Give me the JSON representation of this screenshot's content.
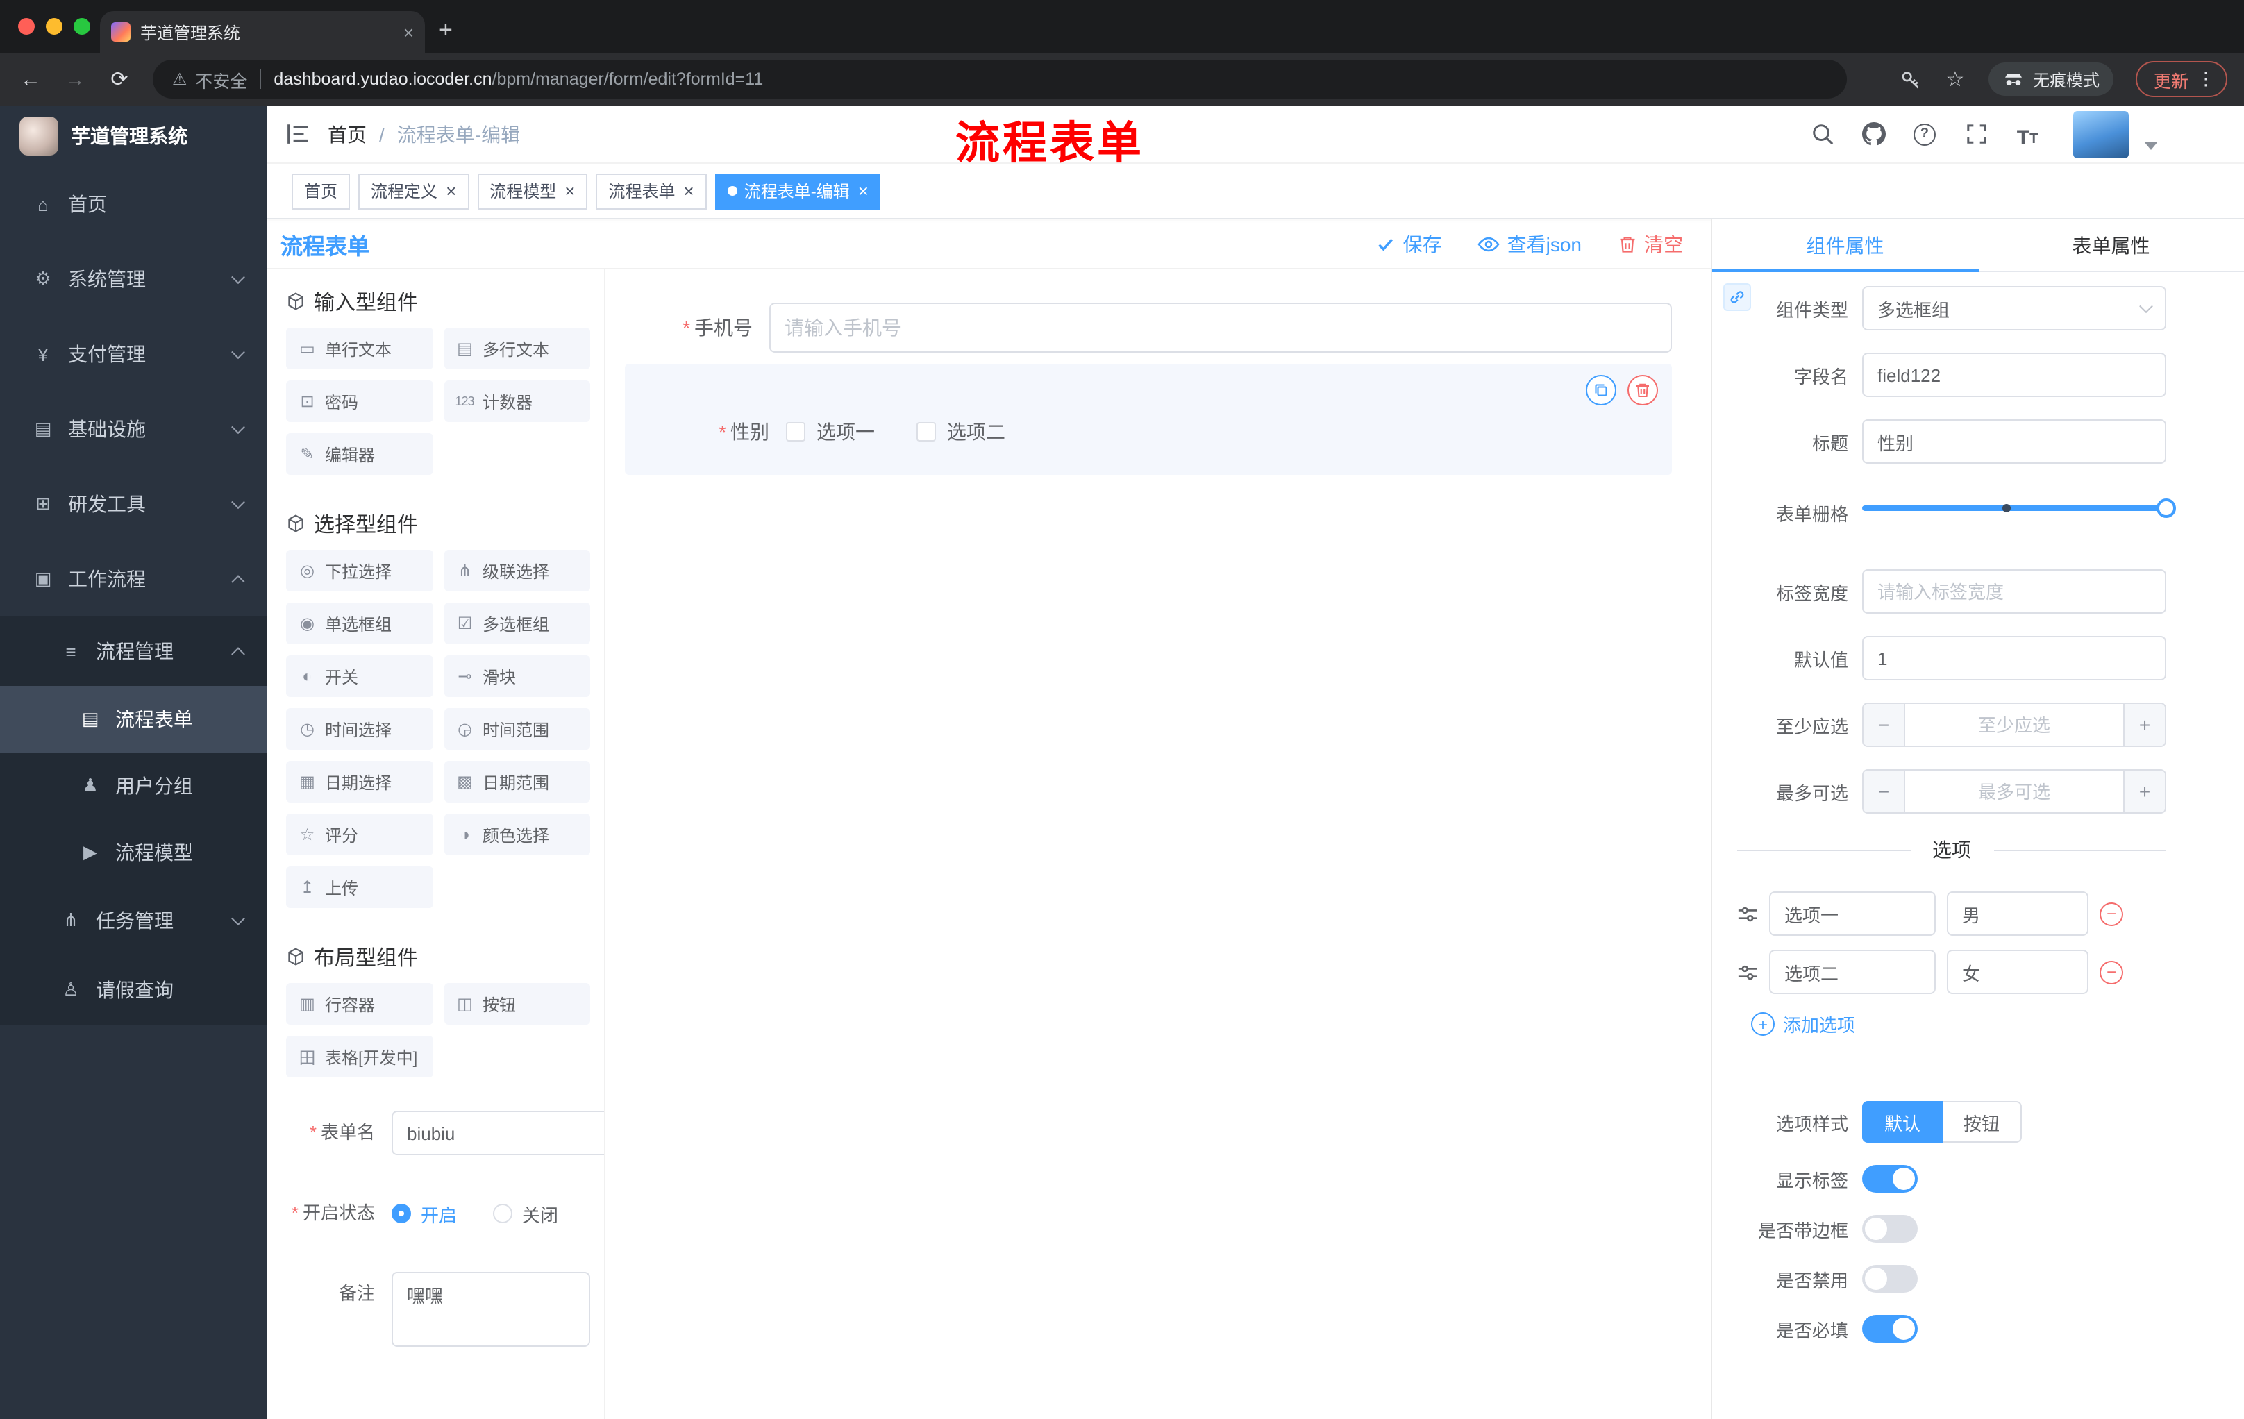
{
  "colors": {
    "accent": "#409eff",
    "danger": "#f56c6c",
    "annotation_red": "#fe0000",
    "sidebar_bg": "#2a333f"
  },
  "glyphs": {
    "close": "×",
    "plus": "+",
    "back": "←",
    "forward": "→",
    "reload": "⟳",
    "warning": "⚠",
    "star": "☆",
    "dots": "⋮",
    "required": "*",
    "minus": "−",
    "help": "?",
    "font_size": "T"
  },
  "browser": {
    "tab_title": "芋道管理系统",
    "security_label": "不安全",
    "url_host": "dashboard.yudao.iocoder.cn",
    "url_path": "/bpm/manager/form/edit?formId=11",
    "incognito_label": "无痕模式",
    "update_label": "更新"
  },
  "sidebar": {
    "app_title": "芋道管理系统",
    "items": [
      {
        "label": "首页",
        "icon": "home-icon",
        "glyph": "⌂"
      },
      {
        "label": "系统管理",
        "icon": "gear-icon",
        "glyph": "⚙"
      },
      {
        "label": "支付管理",
        "icon": "yen-icon",
        "glyph": "¥"
      },
      {
        "label": "基础设施",
        "icon": "infrastructure-icon",
        "glyph": "▤"
      },
      {
        "label": "研发工具",
        "icon": "dev-tools-icon",
        "glyph": "⊞"
      },
      {
        "label": "工作流程",
        "icon": "workflow-icon",
        "glyph": "▣",
        "children": [
          {
            "label": "流程管理",
            "icon": "list-icon",
            "glyph": "≡",
            "children": [
              {
                "label": "流程表单",
                "icon": "form-doc-icon",
                "glyph": "▤"
              },
              {
                "label": "用户分组",
                "icon": "user-group-icon",
                "glyph": "♟"
              },
              {
                "label": "流程模型",
                "icon": "model-icon",
                "glyph": "▶"
              }
            ]
          },
          {
            "label": "任务管理",
            "icon": "task-icon",
            "glyph": "⋔"
          },
          {
            "label": "请假查询",
            "icon": "person-icon",
            "glyph": "♙"
          }
        ]
      }
    ]
  },
  "header": {
    "breadcrumb": {
      "root": "首页",
      "separator": "/",
      "current": "流程表单-编辑"
    },
    "annotation": "流程表单",
    "icons": [
      "search-icon",
      "github-icon",
      "help-icon",
      "fullscreen-icon",
      "font-size-icon",
      "avatar"
    ]
  },
  "tags": {
    "items": [
      {
        "label": "首页",
        "closable": false,
        "active": false
      },
      {
        "label": "流程定义",
        "closable": true,
        "active": false
      },
      {
        "label": "流程模型",
        "closable": true,
        "active": false
      },
      {
        "label": "流程表单",
        "closable": true,
        "active": false
      },
      {
        "label": "流程表单-编辑",
        "closable": true,
        "active": true
      }
    ]
  },
  "designer": {
    "title": "流程表单",
    "actions": {
      "save": {
        "label": "保存",
        "icon": "check-icon"
      },
      "view_json": {
        "label": "查看json",
        "icon": "eye-icon"
      },
      "clear": {
        "label": "清空",
        "icon": "trash-icon"
      }
    },
    "palette": {
      "sections": [
        {
          "title": "输入型组件",
          "icon": "cube-icon",
          "items": [
            {
              "label": "单行文本",
              "icon": "text-field-icon",
              "glyph": "▭"
            },
            {
              "label": "多行文本",
              "icon": "textarea-icon",
              "glyph": "▤"
            },
            {
              "label": "密码",
              "icon": "lock-icon",
              "glyph": "⊡"
            },
            {
              "label": "计数器",
              "icon": "counter-icon",
              "glyph": "123"
            },
            {
              "label": "编辑器",
              "icon": "editor-icon",
              "glyph": "✎"
            }
          ]
        },
        {
          "title": "选择型组件",
          "icon": "cube-icon",
          "items": [
            {
              "label": "下拉选择",
              "icon": "select-icon",
              "glyph": "◎"
            },
            {
              "label": "级联选择",
              "icon": "cascader-icon",
              "glyph": "⋔"
            },
            {
              "label": "单选框组",
              "icon": "radio-icon",
              "glyph": "◉"
            },
            {
              "label": "多选框组",
              "icon": "checkbox-icon",
              "glyph": "☑"
            },
            {
              "label": "开关",
              "icon": "switch-icon",
              "glyph": "◐"
            },
            {
              "label": "滑块",
              "icon": "slider-icon",
              "glyph": "⊸"
            },
            {
              "label": "时间选择",
              "icon": "clock-icon",
              "glyph": "◷"
            },
            {
              "label": "时间范围",
              "icon": "time-range-icon",
              "glyph": "◶"
            },
            {
              "label": "日期选择",
              "icon": "calendar-icon",
              "glyph": "▦"
            },
            {
              "label": "日期范围",
              "icon": "date-range-icon",
              "glyph": "▩"
            },
            {
              "label": "评分",
              "icon": "rate-star-icon",
              "glyph": "☆"
            },
            {
              "label": "颜色选择",
              "icon": "color-icon",
              "glyph": "◑"
            },
            {
              "label": "上传",
              "icon": "upload-ic n",
              "glyph": "↥"
            }
          ]
        },
        {
          "title": "布局型组件",
          "icon": "cube-icon",
          "items": [
            {
              "label": "行容器",
              "icon": "row-container-icon",
              "glyph": "▥"
            },
            {
              "label": "按钮",
              "icon": "button-icon",
              "glyph": "◫"
            },
            {
              "label": "表格[开发中]",
              "icon": "table-icon",
              "glyph": "田"
            }
          ]
        }
      ]
    },
    "meta": {
      "name_label": "表单名",
      "name_value": "biubiu",
      "status_label": "开启状态",
      "status_on": "开启",
      "status_off": "关闭",
      "status_selected": "开启",
      "remark_label": "备注",
      "remark_value": "嘿嘿"
    },
    "canvas": {
      "phone": {
        "label": "手机号",
        "required": true,
        "placeholder": "请输入手机号"
      },
      "gender": {
        "label": "性别",
        "required": true,
        "selected": true,
        "options": [
          {
            "label": "选项一"
          },
          {
            "label": "选项二"
          }
        ]
      }
    }
  },
  "props": {
    "tabs": {
      "component": "组件属性",
      "form": "表单属性"
    },
    "active_tab": "组件属性",
    "rows": {
      "type_label": "组件类型",
      "type_value": "多选框组",
      "field_label": "字段名",
      "field_value": "field122",
      "title_label": "标题",
      "title_value": "性别",
      "grid_label": "表单栅格",
      "width_label": "标签宽度",
      "width_placeholder": "请输入标签宽度",
      "default_label": "默认值",
      "default_value": "1",
      "min_label": "至少应选",
      "min_placeholder": "至少应选",
      "max_label": "最多可选",
      "max_placeholder": "最多可选"
    },
    "options": {
      "divider": "选项",
      "rows": [
        {
          "label": "选项一",
          "value": "男"
        },
        {
          "label": "选项二",
          "value": "女"
        }
      ],
      "add": "添加选项"
    },
    "style": {
      "label": "选项样式",
      "options": [
        {
          "label": "默认",
          "active": true
        },
        {
          "label": "按钮",
          "active": false
        }
      ]
    },
    "switches": [
      {
        "label": "显示标签",
        "on": true
      },
      {
        "label": "是否带边框",
        "on": false
      },
      {
        "label": "是否禁用",
        "on": false
      },
      {
        "label": "是否必填",
        "on": true
      }
    ]
  }
}
